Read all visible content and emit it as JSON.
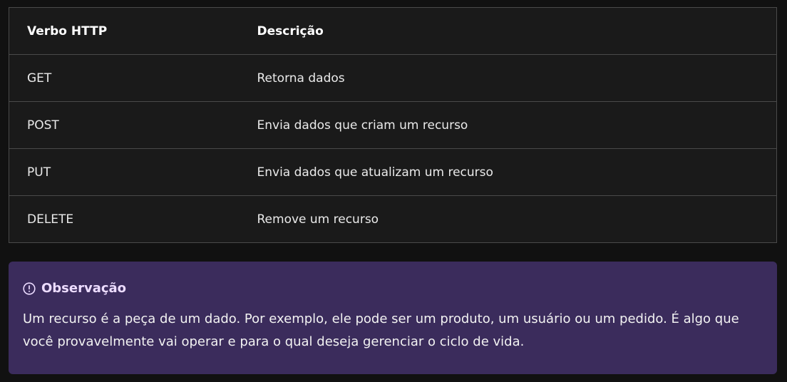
{
  "table": {
    "headers": [
      "Verbo HTTP",
      "Descrição"
    ],
    "rows": [
      [
        "GET",
        "Retorna dados"
      ],
      [
        "POST",
        "Envia dados que criam um recurso"
      ],
      [
        "PUT",
        "Envia dados que atualizam um recurso"
      ],
      [
        "DELETE",
        "Remove um recurso"
      ]
    ]
  },
  "note": {
    "icon": "info-circle-icon",
    "title": "Observação",
    "text": "Um recurso é a peça de um dado. Por exemplo, ele pode ser um produto, um usuário ou um pedido. É algo que você provavelmente vai operar e para o qual deseja gerenciar o ciclo de vida."
  },
  "colors": {
    "page_background": "#111111",
    "table_background": "#1a1a1a",
    "table_border": "#4a4a4a",
    "note_background": "#3b2c5c",
    "note_title": "#ecdcff"
  }
}
